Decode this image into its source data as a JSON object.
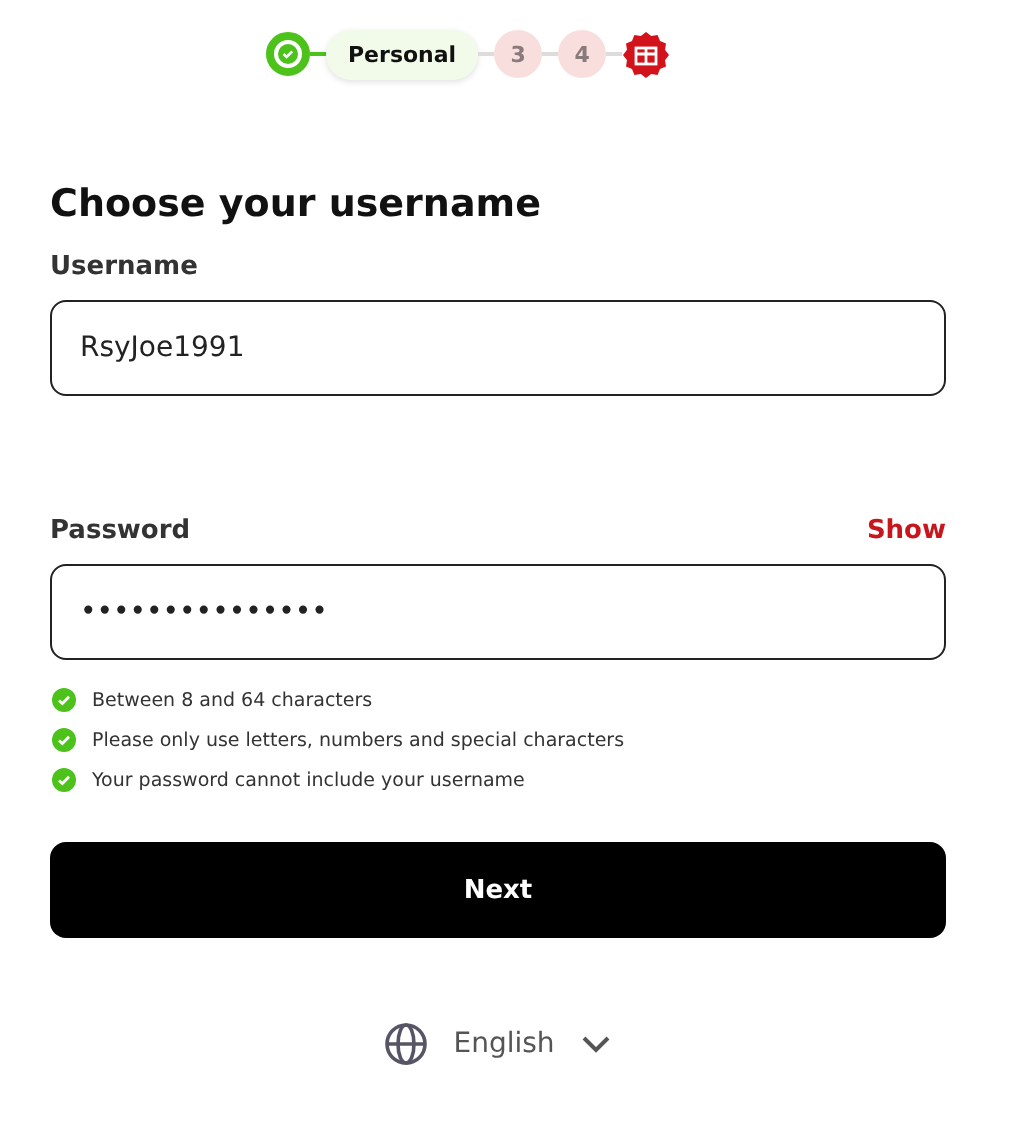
{
  "stepper": [
    {
      "kind": "done"
    },
    {
      "kind": "current",
      "label": "Personal"
    },
    {
      "kind": "number",
      "label": "3"
    },
    {
      "kind": "number",
      "label": "4"
    },
    {
      "kind": "gift"
    }
  ],
  "title": "Choose your username",
  "username": {
    "label": "Username",
    "value": "RsyJoe1991"
  },
  "password": {
    "label": "Password",
    "toggle": "Show",
    "value": "•••••••••••••••"
  },
  "requirements": [
    {
      "text": "Between 8 and 64 characters",
      "met": true
    },
    {
      "text": "Please only use letters, numbers and special characters",
      "met": true
    },
    {
      "text": "Your password cannot include your username",
      "met": true
    }
  ],
  "next_button": "Next",
  "language": "English"
}
